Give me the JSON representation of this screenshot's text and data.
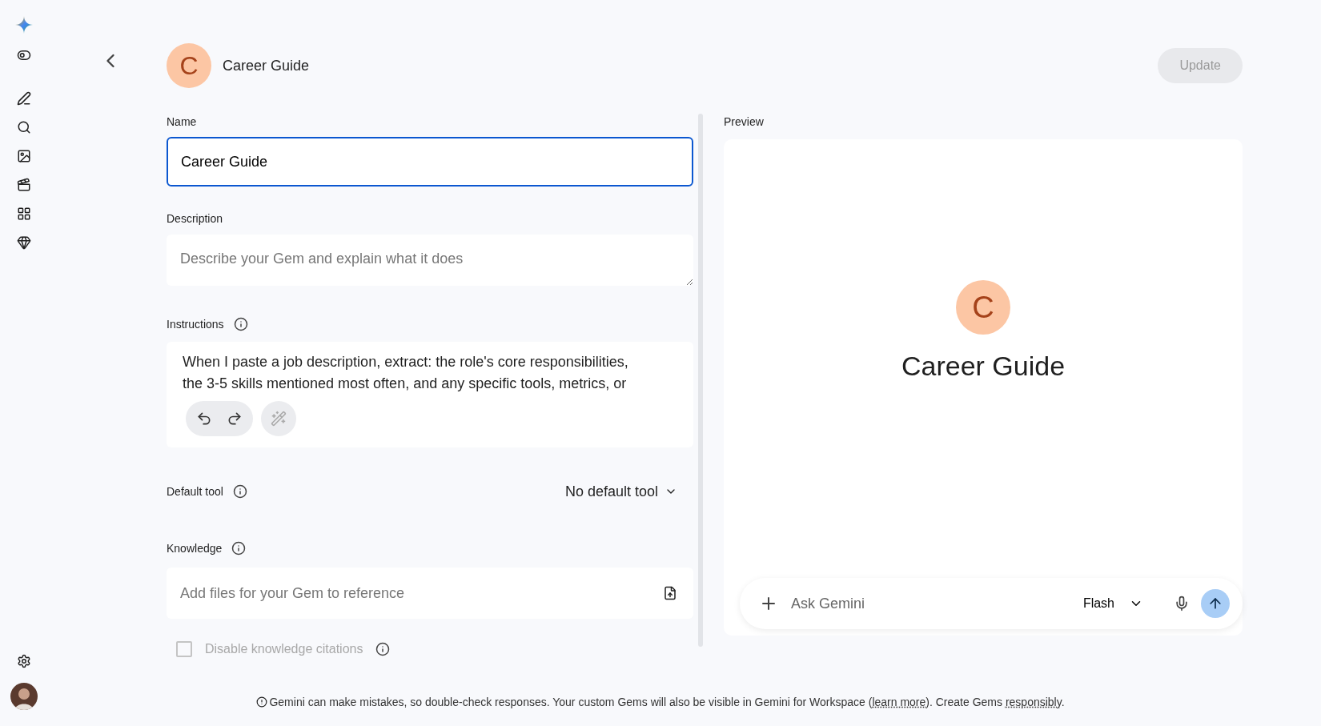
{
  "header": {
    "avatar_letter": "C",
    "title": "Career Guide",
    "update_button": {
      "label": "Update",
      "disabled": true
    }
  },
  "form": {
    "name": {
      "label": "Name",
      "value": "Career Guide",
      "focused": true
    },
    "description": {
      "label": "Description",
      "placeholder": "Describe your Gem and explain what it does"
    },
    "instructions": {
      "label": "Instructions",
      "value": "When I paste a job description, extract: the role's core responsibilities, the 3-5 skills mentioned most often, and any specific tools, metrics, or"
    },
    "default_tool": {
      "label": "Default tool",
      "value": "No default tool"
    },
    "knowledge": {
      "label": "Knowledge",
      "placeholder": "Add files for your Gem to reference"
    },
    "disable_citations": {
      "label": "Disable knowledge citations",
      "checked": false,
      "disabled": true
    }
  },
  "preview": {
    "label": "Preview",
    "avatar_letter": "C",
    "title": "Career Guide",
    "input_placeholder": "Ask Gemini",
    "model": "Flash"
  },
  "footer": {
    "text": "Gemini can make mistakes, so double-check responses. Your custom Gems will also be visible in Gemini for Workspace (",
    "link1": "learn more",
    "middle": "). Create Gems ",
    "link2": "responsibly",
    "end": "."
  }
}
